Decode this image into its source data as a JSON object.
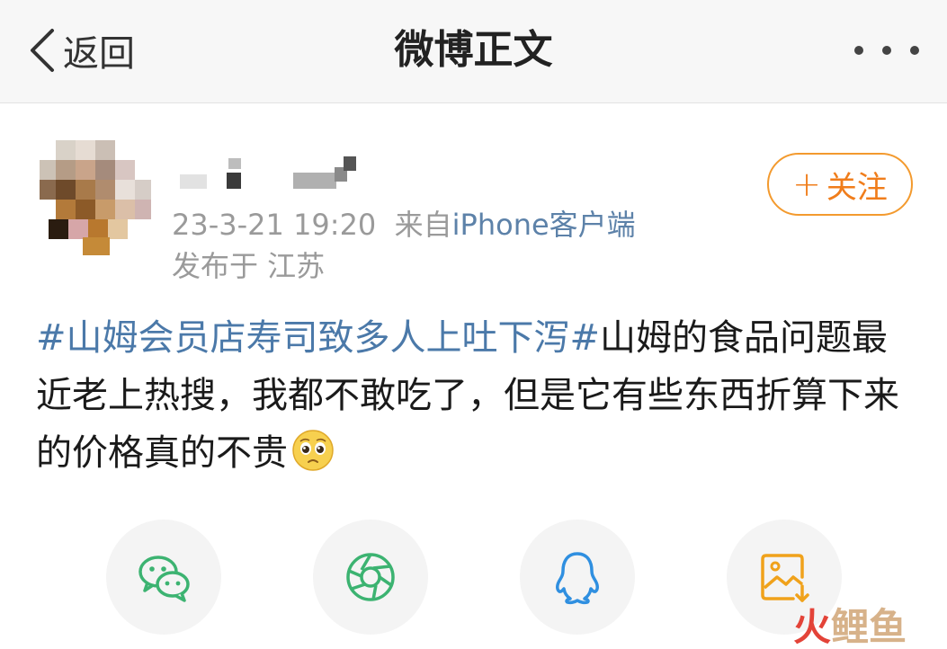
{
  "nav": {
    "back_label": "返回",
    "title": "微博正文"
  },
  "post": {
    "follow_label": "关注",
    "time": "23-3-21 19:20",
    "from_prefix": "来自",
    "source": "iPhone客户端",
    "location": "发布于 江苏",
    "hashtag": "#山姆会员店寿司致多人上吐下泻#",
    "body": "山姆的食品问题最近老上热搜，我都不敢吃了，但是它有些东西折算下来的价格真的不贵",
    "emoji": "pleading-face-emoji"
  },
  "share": {
    "icons": [
      "wechat-icon",
      "moments-icon",
      "qq-icon",
      "save-image-icon"
    ]
  },
  "watermark": {
    "part1": "火",
    "part2": "鲤鱼"
  },
  "colors": {
    "accent": "#f07d1b",
    "link": "#4b79a9",
    "wechat": "#3cb371",
    "qq": "#2f8fe0",
    "save": "#f0a21b"
  }
}
